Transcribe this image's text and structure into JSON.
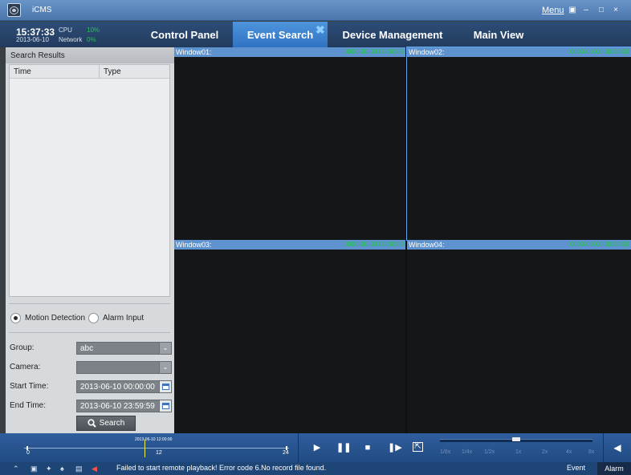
{
  "app": {
    "title": "iCMS",
    "menu_label": "Menu"
  },
  "system": {
    "time": "15:37:33",
    "date": "2013-06-10",
    "cpu_label": "CPU",
    "cpu_value": "10%",
    "network_label": "Network",
    "network_value": "0%"
  },
  "tabs": [
    {
      "label": "Control Panel",
      "active": false
    },
    {
      "label": "Event Search",
      "active": true
    },
    {
      "label": "Device Management",
      "active": false
    },
    {
      "label": "Main View",
      "active": false
    }
  ],
  "search_results": {
    "header": "Search Results",
    "columns": [
      "Time",
      "Type"
    ],
    "rows": []
  },
  "event_type": {
    "options": [
      "Motion Detection",
      "Alarm Input"
    ],
    "selected": "Motion Detection"
  },
  "filters": {
    "group_label": "Group:",
    "group_value": "abc",
    "camera_label": "Camera:",
    "camera_value": "",
    "start_label": "Start Time:",
    "start_value": "2013-06-10 00:00:00",
    "end_label": "End Time:",
    "end_value": "2013-06-10 23:59:59",
    "search_label": "Search"
  },
  "windows": [
    {
      "title": "Window01:",
      "timestamp": "0000-00-00 00:00:00"
    },
    {
      "title": "Window02:",
      "timestamp": "0000-00-00 00:00:00"
    },
    {
      "title": "Window03:",
      "timestamp": "0000-00-00 00:00:00"
    },
    {
      "title": "Window04:",
      "timestamp": "0000-00-00 00:00:00"
    }
  ],
  "timeline": {
    "start": "0",
    "middle": "12",
    "end": "24",
    "cursor_label": "2013-06-10 12:00:00"
  },
  "speeds": [
    "1/8x",
    "1/4x",
    "1/2x",
    "1x",
    "2x",
    "4x",
    "8x"
  ],
  "status": {
    "message": "Failed to start remote playback! Error code 6.No record file found.",
    "event_label": "Event",
    "alarm_label": "Alarm"
  },
  "colors": {
    "accent": "#2f72c2",
    "titlebar": "#5a86bd",
    "timestamp_green": "#23c93a",
    "panel_bg": "#d7dadd"
  }
}
